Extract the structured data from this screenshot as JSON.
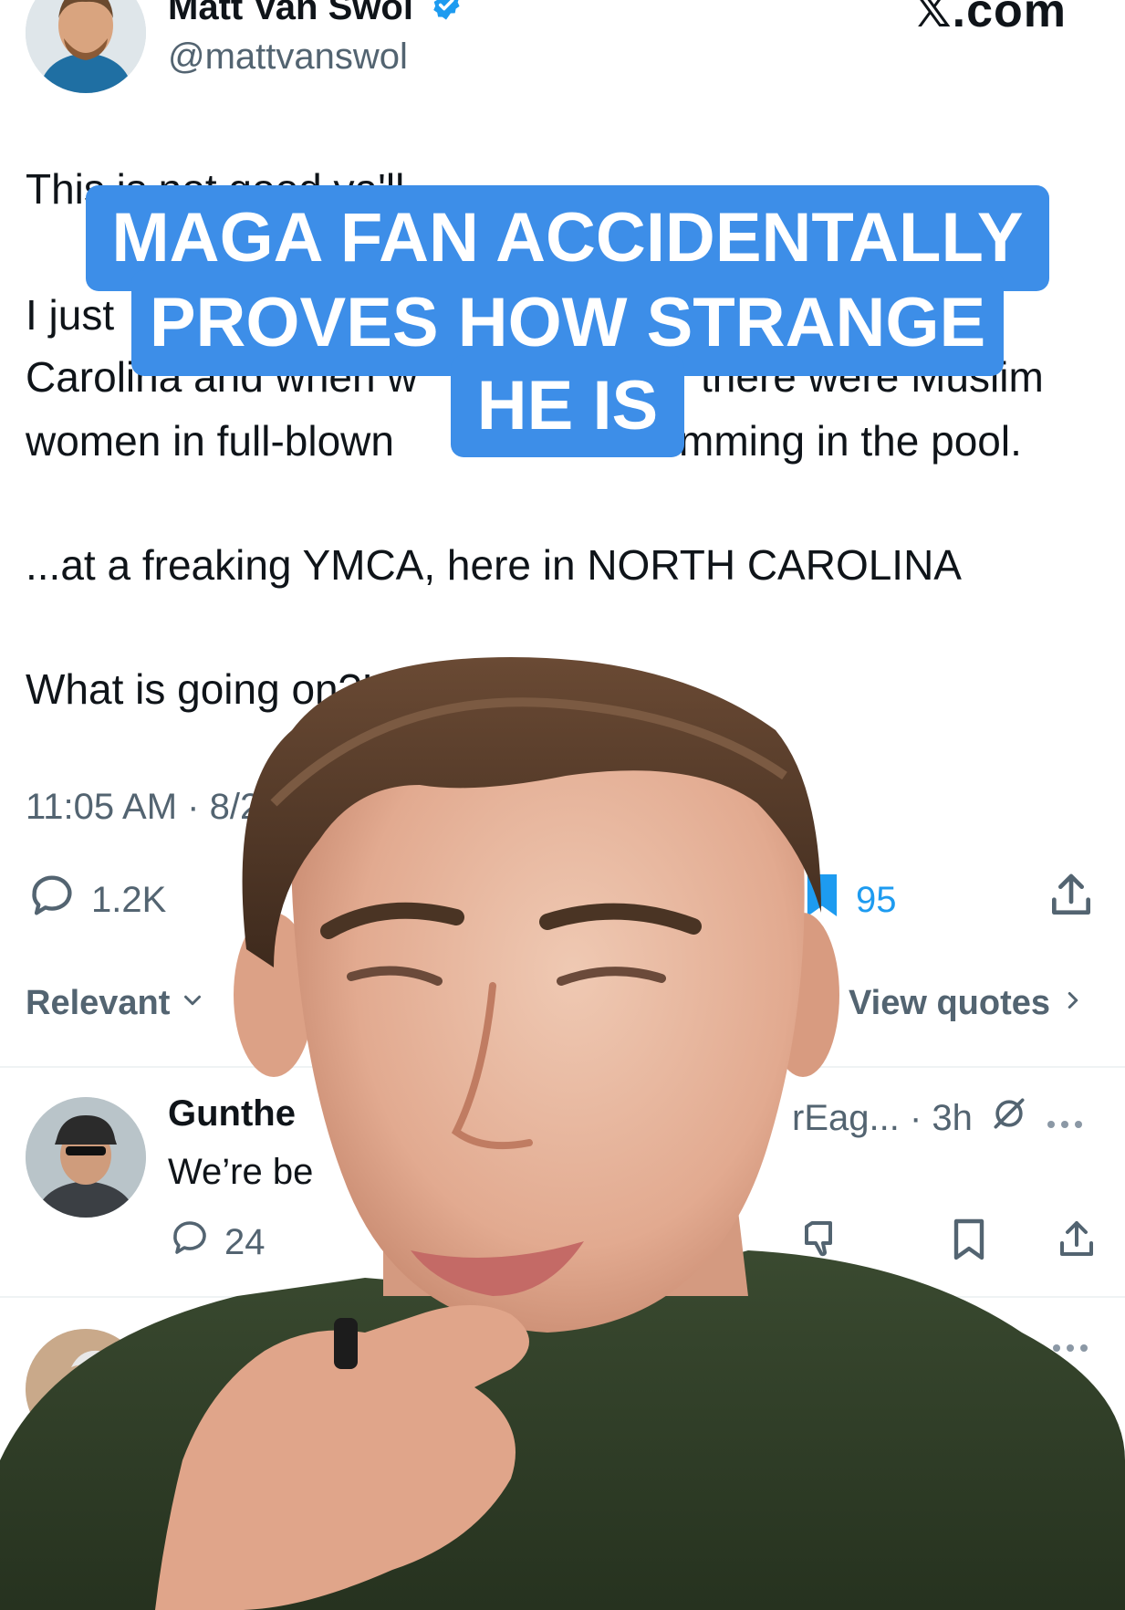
{
  "header": {
    "author_name": "Matt Van Swol",
    "author_handle": "@mattvanswol",
    "site_label": "𝕏.com",
    "verified_icon": "verified-badge-icon"
  },
  "tweet": {
    "lines": [
      "This is not good ya'll",
      "I just",
      "Carolina and when w",
      "there were Muslim",
      "women in full-blown",
      "mming in the pool.",
      "...at a freaking YMCA, here in NORTH CAROLINA",
      "What is going on?!!!!"
    ],
    "timestamp": "11:05 AM · 8/2/",
    "replies_count": "1.2K",
    "likes_count": "95"
  },
  "sort": {
    "label": "Relevant",
    "view_quotes": "View quotes"
  },
  "replies": [
    {
      "name": "Gunthe",
      "handle_meta": "rEag... · 3h",
      "text": "We’re be",
      "reply_count": "24"
    }
  ],
  "caption": {
    "line1": "MAGA FAN ACCIDENTALLY",
    "line2": "PROVES HOW STRANGE",
    "line3": "HE IS"
  },
  "colors": {
    "caption_bg": "#3d8ee8",
    "accent": "#1d9bf0",
    "muted": "#536471"
  }
}
